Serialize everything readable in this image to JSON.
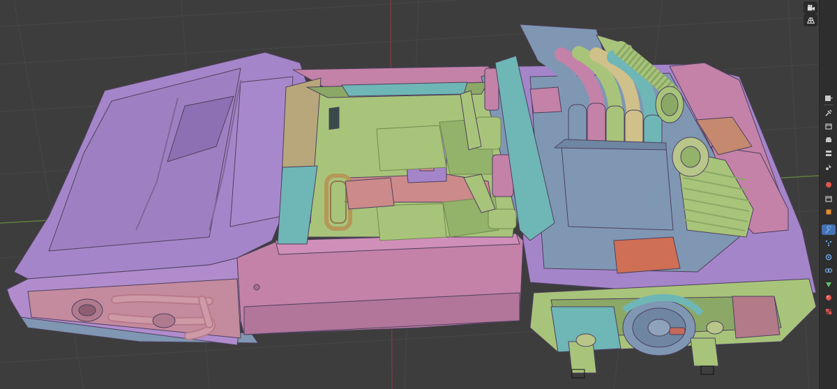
{
  "app": {
    "accent_color": "#4772b3",
    "viewport_background": "#3d3d3d",
    "viewport": {
      "shading": "solid-random-color",
      "grid_visible": true
    }
  },
  "viewport_nav": [
    {
      "name": "camera-view-icon"
    },
    {
      "name": "grid-view-icon"
    }
  ],
  "properties_toolbar": {
    "active_tab": "modifier-wrench-icon",
    "tabs": [
      {
        "icon": "tool-settings-icon",
        "color": "#c8c8c8"
      },
      {
        "icon": "render-properties-icon",
        "color": "#c8c8c8"
      },
      {
        "icon": "output-properties-icon",
        "color": "#c8c8c8"
      },
      {
        "icon": "view-layer-icon",
        "color": "#c8c8c8"
      },
      {
        "icon": "scene-icon",
        "color": "#c8c8c8"
      },
      {
        "icon": "world-icon",
        "color": "#e0554a"
      },
      {
        "icon": "collection-icon",
        "color": "#c8c8c8"
      },
      {
        "icon": "object-properties-icon",
        "color": "#e58c2c"
      },
      {
        "icon": "modifier-wrench-icon",
        "color": "#6aa8e8"
      },
      {
        "icon": "particles-icon",
        "color": "#6aa8e8"
      },
      {
        "icon": "physics-icon",
        "color": "#6aa8e8"
      },
      {
        "icon": "constraints-icon",
        "color": "#6aa8e8"
      },
      {
        "icon": "object-data-icon",
        "color": "#5ec36a"
      },
      {
        "icon": "material-icon",
        "color": "#e0554a"
      },
      {
        "icon": "texture-icon",
        "color": "#e0554a"
      }
    ]
  },
  "model": {
    "palette": {
      "body": "#a585c9",
      "body_dark": "#8c70b3",
      "pink": "#c482a8",
      "pink_dark": "#a96d8f",
      "green": "#a8c47a",
      "green_dark": "#8ba866",
      "teal": "#6fb6b6",
      "blue_gray": "#7f97b3",
      "orange": "#c4896f",
      "salmon": "#cf8a8a",
      "rose": "#cc8a8a"
    }
  }
}
